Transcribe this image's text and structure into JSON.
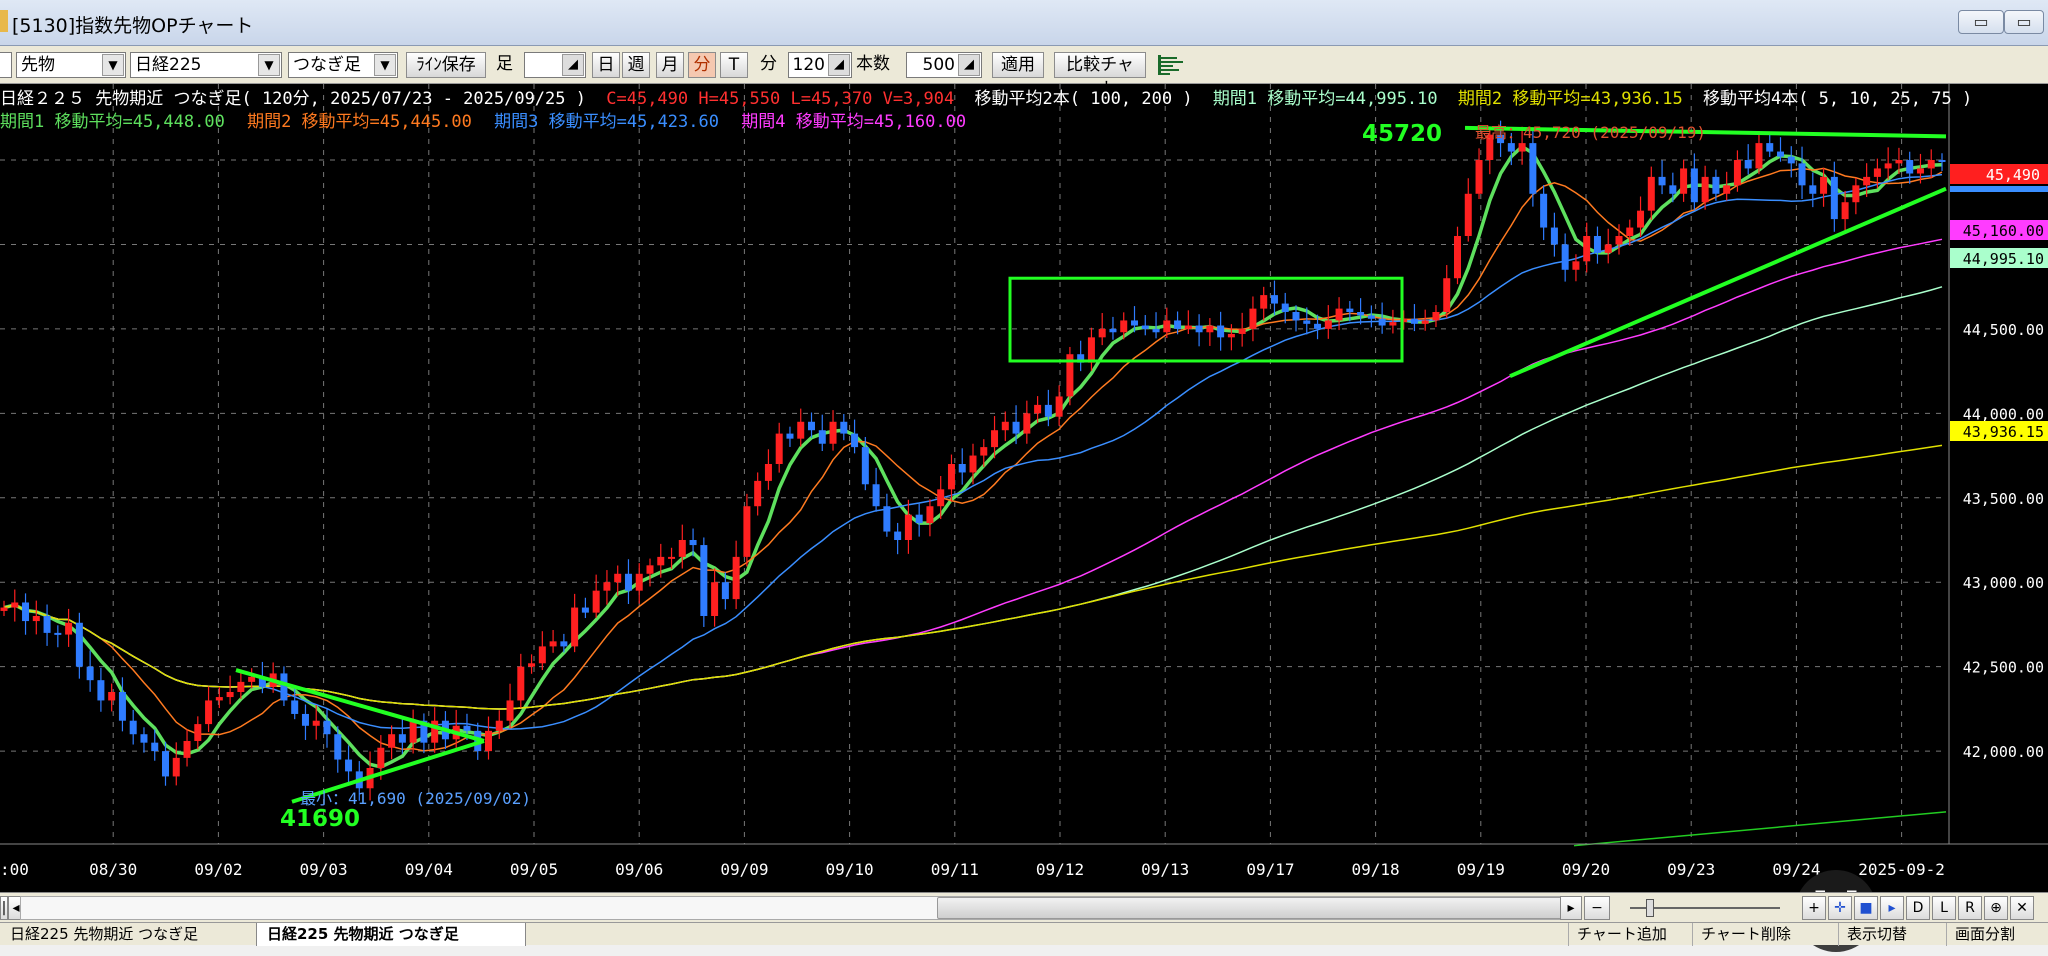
{
  "window": {
    "title": "[5130]指数先物OPチャート",
    "minimize_label": "▭",
    "maximize_label": "▭"
  },
  "toolbar": {
    "market_select": "先物",
    "symbol_select": "日経225",
    "continuity_select": "つなぎ足",
    "line_save_label": "ﾗｲﾝ保存",
    "foot_label": "足",
    "day_label": "日",
    "week_label": "週",
    "month_label": "月",
    "minute_label": "分",
    "tick_label": "T",
    "minute_unit_label": "分",
    "interval_value": "120",
    "count_label": "本数",
    "count_value": "500",
    "apply_label": "適用",
    "compare_label": "比較チャート"
  },
  "header": {
    "line1_name": "日経２２５ 先物期近 つなぎ足( 120分, 2025/07/23 - 2025/09/25 )",
    "line1_ohlc": "C=45,490 H=45,550 L=45,370 V=3,904",
    "line1_ma_title": "移動平均2本( 100, 200 )",
    "line1_p1": "期間1 移動平均=44,995.10",
    "line1_p2": "期間2 移動平均=43,936.15",
    "line1_ma4_title": "移動平均4本( 5, 10, 25, 75 )",
    "line2_p1": "期間1 移動平均=45,448.00",
    "line2_p2": "期間2 移動平均=45,445.00",
    "line2_p3": "期間3 移動平均=45,423.60",
    "line2_p4": "期間4 移動平均=45,160.00"
  },
  "annotations": {
    "high_value": "45720",
    "high_note": "最高：45,720 (2025/09/19)",
    "low_value": "41690",
    "low_note": "最小：41,690 (2025/09/02)"
  },
  "price_tags": {
    "close": "45,490",
    "ma4_p4": "45,160.00",
    "ma2_p1": "44,995.10",
    "ma2_p2": "43,936.15"
  },
  "tabs": {
    "tab1": "日経225 先物期近 つなぎ足",
    "tab2": "日経225 先物期近 つなぎ足",
    "chart_add": "チャート追加",
    "chart_delete": "チャート削除",
    "display_switch": "表示切替",
    "screen_split": "画面分割"
  },
  "bottom_buttons": [
    "|",
    "◂",
    "▸",
    "−",
    "+",
    "✛",
    "■",
    "▸",
    "D",
    "L",
    "R",
    "⊕",
    "✕"
  ],
  "colors": {
    "candle_up": "#ff2020",
    "candle_down": "#2f7cff",
    "ma5": "#5ee05e",
    "ma10": "#ff7a20",
    "ma25": "#3a8eff",
    "ma75": "#ff3cff",
    "ma100": "#aaffcc",
    "ma200": "#e0e000",
    "trendline": "#22ff22"
  },
  "chart_data": {
    "type": "candlestick",
    "title": "日経２２５ 先物期近 つなぎ足( 120分, 2025/07/23 - 2025/09/25 )",
    "y_ticks": [
      "44,500.00",
      "44,000.00",
      "43,500.00",
      "43,000.00",
      "42,500.00",
      "42,000.00"
    ],
    "y_tick_values": [
      44500,
      44000,
      43500,
      43000,
      42500,
      42000
    ],
    "ylim": [
      41450,
      45950
    ],
    "x_ticks": [
      ":00",
      "08/30",
      "09/02",
      "09/03",
      "09/04",
      "09/05",
      "09/06",
      "09/09",
      "09/10",
      "09/11",
      "09/12",
      "09/13",
      "09/17",
      "09/18",
      "09/19",
      "09/20",
      "09/23",
      "09/24",
      "2025-09-2"
    ],
    "closes": [
      42850,
      42880,
      42770,
      42800,
      42700,
      42690,
      42760,
      42500,
      42420,
      42300,
      42350,
      42180,
      42100,
      42050,
      42000,
      41850,
      41960,
      42060,
      42160,
      42300,
      42320,
      42350,
      42410,
      42440,
      42380,
      42460,
      42300,
      42220,
      42150,
      42180,
      42100,
      41950,
      41880,
      41780,
      41900,
      42020,
      42100,
      42050,
      42180,
      42050,
      42180,
      42070,
      42150,
      42120,
      42000,
      42120,
      42180,
      42300,
      42500,
      42520,
      42620,
      42650,
      42620,
      42850,
      42820,
      42950,
      43000,
      43050,
      42950,
      43050,
      43100,
      43150,
      43150,
      43250,
      43220,
      42800,
      43000,
      42900,
      43150,
      43450,
      43600,
      43700,
      43880,
      43850,
      43950,
      43900,
      43820,
      43950,
      43880,
      43800,
      43580,
      43450,
      43300,
      43250,
      43400,
      43350,
      43450,
      43550,
      43700,
      43650,
      43750,
      43800,
      43900,
      43950,
      43880,
      44000,
      44050,
      43980,
      44100,
      44350,
      44300,
      44450,
      44500,
      44480,
      44550,
      44520,
      44500,
      44480,
      44550,
      44500,
      44520,
      44480,
      44520,
      44450,
      44470,
      44500,
      44620,
      44700,
      44650,
      44600,
      44550,
      44530,
      44500,
      44550,
      44620,
      44600,
      44580,
      44560,
      44520,
      44540,
      44560,
      44530,
      44550,
      44600,
      44800,
      45050,
      45300,
      45500,
      45650,
      45600,
      45550,
      45600,
      45300,
      45100,
      45000,
      44850,
      44900,
      45050,
      44950,
      45000,
      45050,
      45100,
      45200,
      45400,
      45350,
      45300,
      45450,
      45250,
      45400,
      45300,
      45350,
      45500,
      45450,
      45600,
      45550,
      45520,
      45480,
      45350,
      45300,
      45400,
      45150,
      45250,
      45350,
      45400,
      45450,
      45480,
      45500,
      45420,
      45450,
      45500,
      45490
    ],
    "ma_series": [
      {
        "name": "期間1 移動平均",
        "group": "移動平均4本",
        "period": 5
      },
      {
        "name": "期間2 移動平均",
        "group": "移動平均4本",
        "period": 10
      },
      {
        "name": "期間3 移動平均",
        "group": "移動平均4本",
        "period": 25
      },
      {
        "name": "期間4 移動平均",
        "group": "移動平均4本",
        "period": 75
      },
      {
        "name": "期間1 移動平均",
        "group": "移動平均2本",
        "period": 100
      },
      {
        "name": "期間2 移動平均",
        "group": "移動平均2本",
        "period": 200
      }
    ],
    "last": {
      "close": 45490,
      "high": 45550,
      "low": 45370,
      "volume": 3904
    },
    "high": {
      "value": 45720,
      "date": "2025/09/19"
    },
    "low": {
      "value": 41690,
      "date": "2025/09/02"
    },
    "grid": true
  }
}
